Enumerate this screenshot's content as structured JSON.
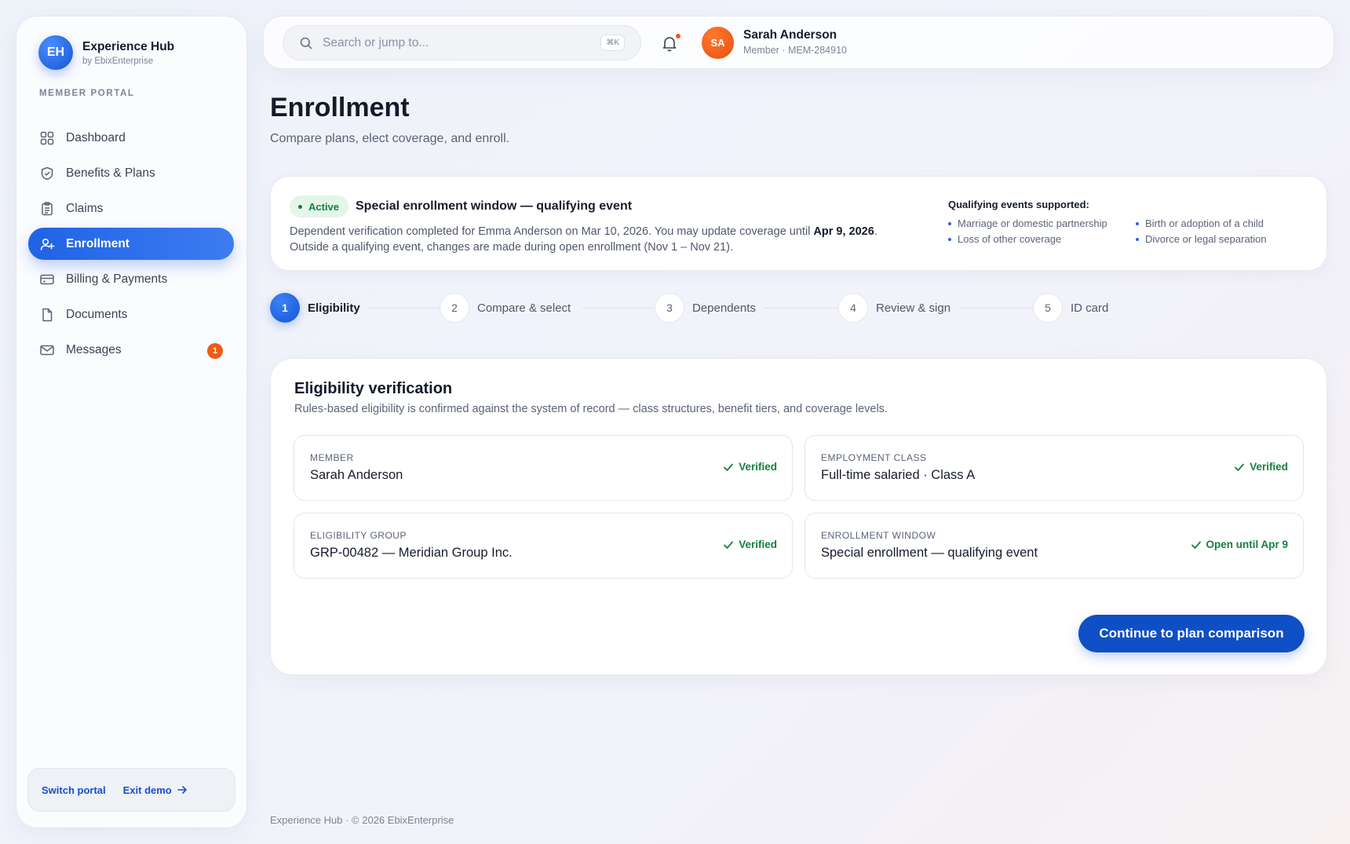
{
  "brand": {
    "logo": "EH",
    "name": "Experience Hub",
    "sub": "by EbixEnterprise"
  },
  "sidebar": {
    "section_label": "MEMBER PORTAL",
    "items": [
      {
        "label": "Dashboard",
        "icon": "grid-icon"
      },
      {
        "label": "Benefits & Plans",
        "icon": "shield-check-icon"
      },
      {
        "label": "Claims",
        "icon": "clipboard-icon"
      },
      {
        "label": "Enrollment",
        "icon": "user-plus-icon",
        "active": true
      },
      {
        "label": "Billing & Payments",
        "icon": "credit-card-icon"
      },
      {
        "label": "Documents",
        "icon": "document-icon"
      },
      {
        "label": "Messages",
        "icon": "mail-icon",
        "badge": "1"
      }
    ],
    "footer": {
      "switch": "Switch portal",
      "exit": "Exit demo"
    }
  },
  "topbar": {
    "search_placeholder": "Search or jump to...",
    "shortcut": "⌘K",
    "user": {
      "initials": "SA",
      "name": "Sarah Anderson",
      "id": "Member · MEM-284910"
    }
  },
  "page": {
    "title": "Enrollment",
    "subtitle": "Compare plans, elect coverage, and enroll."
  },
  "banner": {
    "status": "Active",
    "title": "Special enrollment window — qualifying event",
    "text_pre": "Dependent verification completed for Emma Anderson on Mar 10, 2026. You may update coverage until ",
    "text_date": "Apr 9, 2026",
    "text_post": ".",
    "text_line2": "Outside a qualifying event, changes are made during open enrollment (Nov 1 – Nov 21).",
    "events_title": "Qualifying events supported:",
    "events": [
      "Marriage or domestic partnership",
      "Birth or adoption of a child",
      "Loss of other coverage",
      "Divorce or legal separation"
    ]
  },
  "steps": [
    {
      "num": "1",
      "label": "Eligibility",
      "active": true
    },
    {
      "num": "2",
      "label": "Compare & select"
    },
    {
      "num": "3",
      "label": "Dependents"
    },
    {
      "num": "4",
      "label": "Review & sign"
    },
    {
      "num": "5",
      "label": "ID card"
    }
  ],
  "eligibility": {
    "title": "Eligibility verification",
    "subtitle": "Rules-based eligibility is confirmed against the system of record — class structures, benefit tiers, and coverage levels.",
    "items": [
      {
        "label": "MEMBER",
        "value": "Sarah Anderson",
        "status": "Verified"
      },
      {
        "label": "EMPLOYMENT CLASS",
        "value": "Full-time salaried · Class A",
        "status": "Verified"
      },
      {
        "label": "ELIGIBILITY GROUP",
        "value": "GRP-00482 — Meridian Group Inc.",
        "status": "Verified"
      },
      {
        "label": "ENROLLMENT WINDOW",
        "value": "Special enrollment — qualifying event",
        "status": "Open until Apr 9"
      }
    ],
    "cta": "Continue to plan comparison"
  },
  "footer": "Experience Hub · © 2026 EbixEnterprise",
  "colors": {
    "accent": "#1f63e6",
    "success": "#15803d",
    "alert": "#f05a12"
  }
}
